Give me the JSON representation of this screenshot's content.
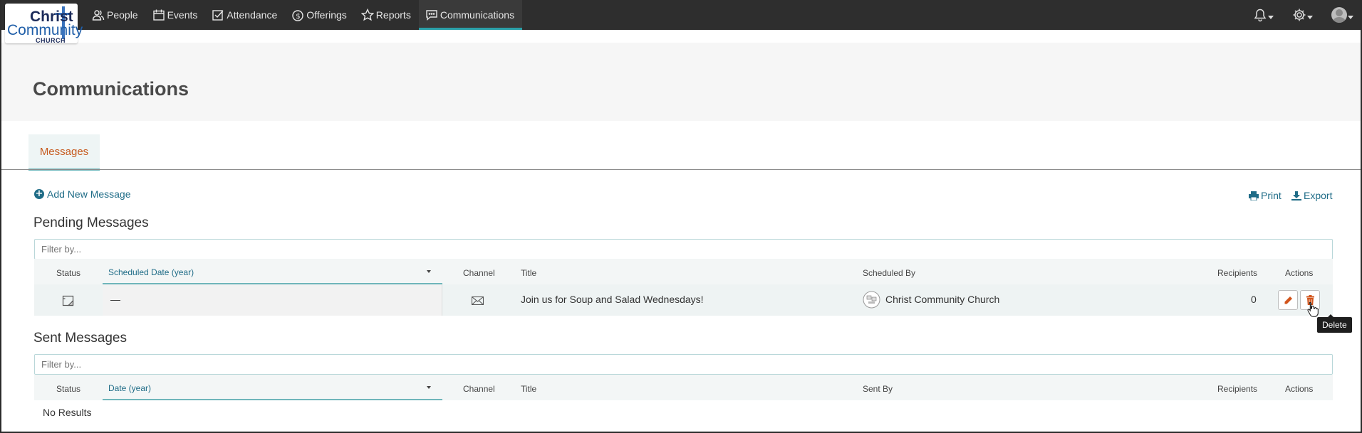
{
  "logo": {
    "line1": "Christ",
    "line2": "Community",
    "line3": "CHURCH"
  },
  "nav": {
    "items": [
      {
        "label": "People",
        "icon": "people-icon"
      },
      {
        "label": "Events",
        "icon": "calendar-icon"
      },
      {
        "label": "Attendance",
        "icon": "checkbox-icon"
      },
      {
        "label": "Offerings",
        "icon": "coin-icon"
      },
      {
        "label": "Reports",
        "icon": "star-icon"
      },
      {
        "label": "Communications",
        "icon": "chat-icon",
        "active": true
      }
    ],
    "right_icons": [
      "bell-icon",
      "gear-icon",
      "avatar"
    ]
  },
  "page": {
    "title": "Communications"
  },
  "tabs": [
    {
      "label": "Messages",
      "active": true
    }
  ],
  "actions": {
    "add_new": "Add New Message",
    "print": "Print",
    "export": "Export"
  },
  "pending": {
    "title": "Pending Messages",
    "filter_placeholder": "Filter by...",
    "columns": {
      "status": "Status",
      "date": "Scheduled Date (year)",
      "channel": "Channel",
      "title": "Title",
      "by": "Scheduled By",
      "recipients": "Recipients",
      "actions": "Actions"
    },
    "rows": [
      {
        "status_icon": "draft-icon",
        "date": "—",
        "channel_icon": "email-icon",
        "title": "Join us for Soup and Salad Wednesdays!",
        "by": "Christ Community Church",
        "recipients": "0"
      }
    ],
    "tooltip": "Delete"
  },
  "sent": {
    "title": "Sent Messages",
    "filter_placeholder": "Filter by...",
    "columns": {
      "status": "Status",
      "date": "Date (year)",
      "channel": "Channel",
      "title": "Title",
      "by": "Sent By",
      "recipients": "Recipients",
      "actions": "Actions"
    },
    "empty": "No Results"
  },
  "colors": {
    "accent": "#1f6c87",
    "tab_active_text": "#c65a1e",
    "delete": "#d2541b",
    "nav_bg": "#2e2e2e"
  }
}
